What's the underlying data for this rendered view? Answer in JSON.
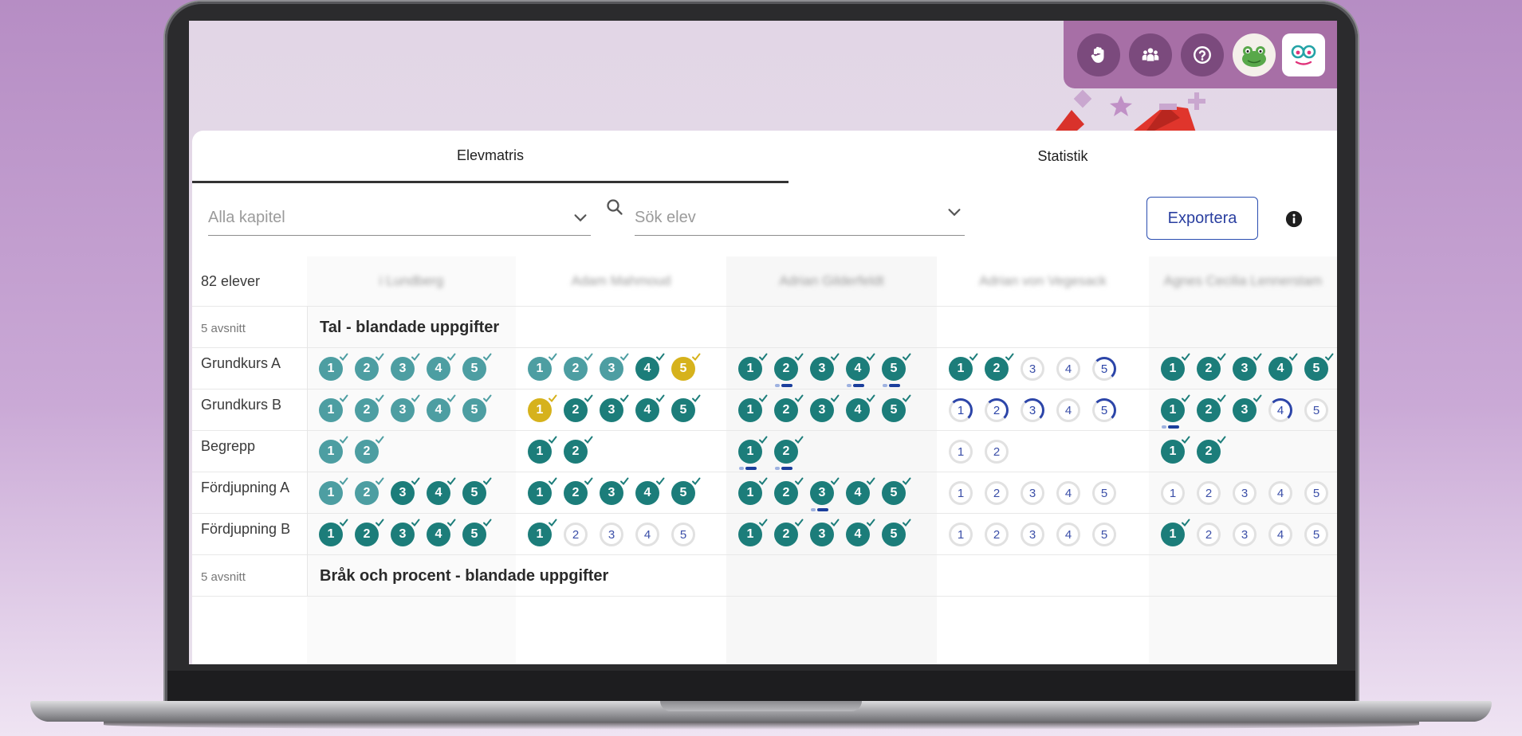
{
  "topbar": {
    "icons": [
      "raised-hand-icon",
      "group-icon",
      "help-icon",
      "frog-avatar-icon",
      "app-logo-icon"
    ]
  },
  "tabs": [
    {
      "label": "Elevmatris",
      "active": true
    },
    {
      "label": "Statistik",
      "active": false
    }
  ],
  "filters": {
    "chapter_placeholder": "Alla kapitel",
    "student_placeholder": "Sök elev",
    "export_label": "Exportera"
  },
  "matrix": {
    "student_count": "82 elever",
    "students": [
      "i Lundberg",
      "Adam Mahmoud",
      "Adrian Gilderfeldt",
      "Adrian von Vegesack",
      "Agnes Cecilia Lennerstam"
    ],
    "chapters": [
      {
        "sections": "5 avsnitt",
        "title": "Tal - blandade uppgifter",
        "rows": [
          {
            "label": "Grundkurs A",
            "cells": [
              [
                "dl",
                "dl",
                "dl",
                "dl",
                "dl"
              ],
              [
                "dl",
                "dl",
                "dl",
                "d",
                "g"
              ],
              [
                "d",
                "d",
                "d",
                "d",
                "d"
              ],
              [
                "d",
                "d",
                "e",
                "e",
                "p"
              ],
              [
                "d",
                "d",
                "d",
                "d",
                "d"
              ]
            ]
          },
          {
            "label": "Grundkurs B",
            "cells": [
              [
                "dl",
                "dl",
                "dl",
                "dl",
                "dl"
              ],
              [
                "g",
                "d",
                "d",
                "d",
                "d"
              ],
              [
                "d",
                "d",
                "d",
                "d",
                "d"
              ],
              [
                "p",
                "p",
                "p",
                "e",
                "p"
              ],
              [
                "d",
                "d",
                "d",
                "p",
                "e"
              ]
            ]
          },
          {
            "label": "Begrepp",
            "cells": [
              [
                "dl",
                "dl"
              ],
              [
                "d",
                "d"
              ],
              [
                "d",
                "d"
              ],
              [
                "e",
                "e"
              ],
              [
                "d",
                "d"
              ]
            ]
          },
          {
            "label": "Fördjupning A",
            "cells": [
              [
                "dl",
                "dl",
                "d",
                "d",
                "d"
              ],
              [
                "d",
                "d",
                "d",
                "d",
                "d"
              ],
              [
                "d",
                "d",
                "d",
                "d",
                "d"
              ],
              [
                "e",
                "e",
                "e",
                "e",
                "e"
              ],
              [
                "e",
                "e",
                "e",
                "e",
                "e"
              ]
            ]
          },
          {
            "label": "Fördjupning B",
            "cells": [
              [
                "d",
                "d",
                "d",
                "d",
                "d"
              ],
              [
                "d",
                "e",
                "e",
                "e",
                "e"
              ],
              [
                "d",
                "d",
                "d",
                "d",
                "d"
              ],
              [
                "e",
                "e",
                "e",
                "e",
                "e"
              ],
              [
                "d",
                "e",
                "e",
                "e",
                "e"
              ]
            ]
          }
        ]
      },
      {
        "sections": "5 avsnitt",
        "title": "Bråk och procent - blandade uppgifter"
      }
    ]
  },
  "colors": {
    "accent": "#1c7d7a",
    "accent_light": "#4d9ea2",
    "gold": "#d6b21c",
    "link_blue": "#2a3fa0",
    "topbar": "#a76fa6"
  }
}
